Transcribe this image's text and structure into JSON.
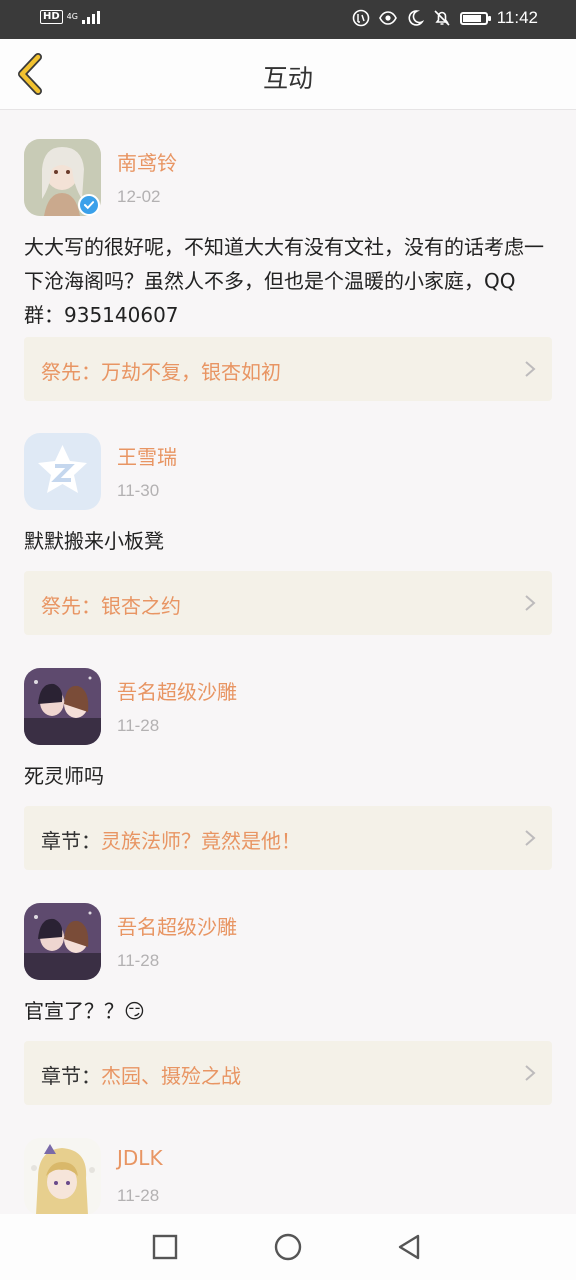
{
  "status_bar": {
    "hd_badge": "HD",
    "network": "4G",
    "time": "11:42",
    "battery_level": 0.85
  },
  "header": {
    "title": "互动"
  },
  "feed": [
    {
      "user": "南鸢铃",
      "date": "12-02",
      "verified": true,
      "comment": "大大写的很好呢，不知道大大有没有文社，没有的话考虑一下沧海阁吗？虽然人不多，但也是个温暖的小家庭，QQ群：935140607",
      "ref_label": "祭先：",
      "ref_title": "万劫不复，银杏如初"
    },
    {
      "user": "王雪瑞",
      "date": "11-30",
      "verified": false,
      "comment": "默默搬来小板凳",
      "ref_label": "祭先：",
      "ref_title": "银杏之约"
    },
    {
      "user": "吾名超级沙雕",
      "date": "11-28",
      "verified": false,
      "comment": "死灵师吗",
      "ref_label": "章节：",
      "ref_title": "灵族法师？竟然是他！"
    },
    {
      "user": "吾名超级沙雕",
      "date": "11-28",
      "verified": false,
      "comment": "官宣了？？😏",
      "ref_label": "章节：",
      "ref_title": "杰园、摄殓之战"
    },
    {
      "user": "JDLK",
      "date": "11-28",
      "verified": false
    }
  ],
  "icons": {
    "back": "chevron-left-icon",
    "verified": "verified-badge-icon",
    "chevron": "chevron-right-icon",
    "nav_recent": "square-icon",
    "nav_home": "circle-icon",
    "nav_back": "triangle-back-icon"
  },
  "colors": {
    "accent": "#e89563",
    "back_arrow": "#f2c230",
    "ref_bg": "#f4f1e8",
    "page_bg": "#f8f6f7"
  }
}
